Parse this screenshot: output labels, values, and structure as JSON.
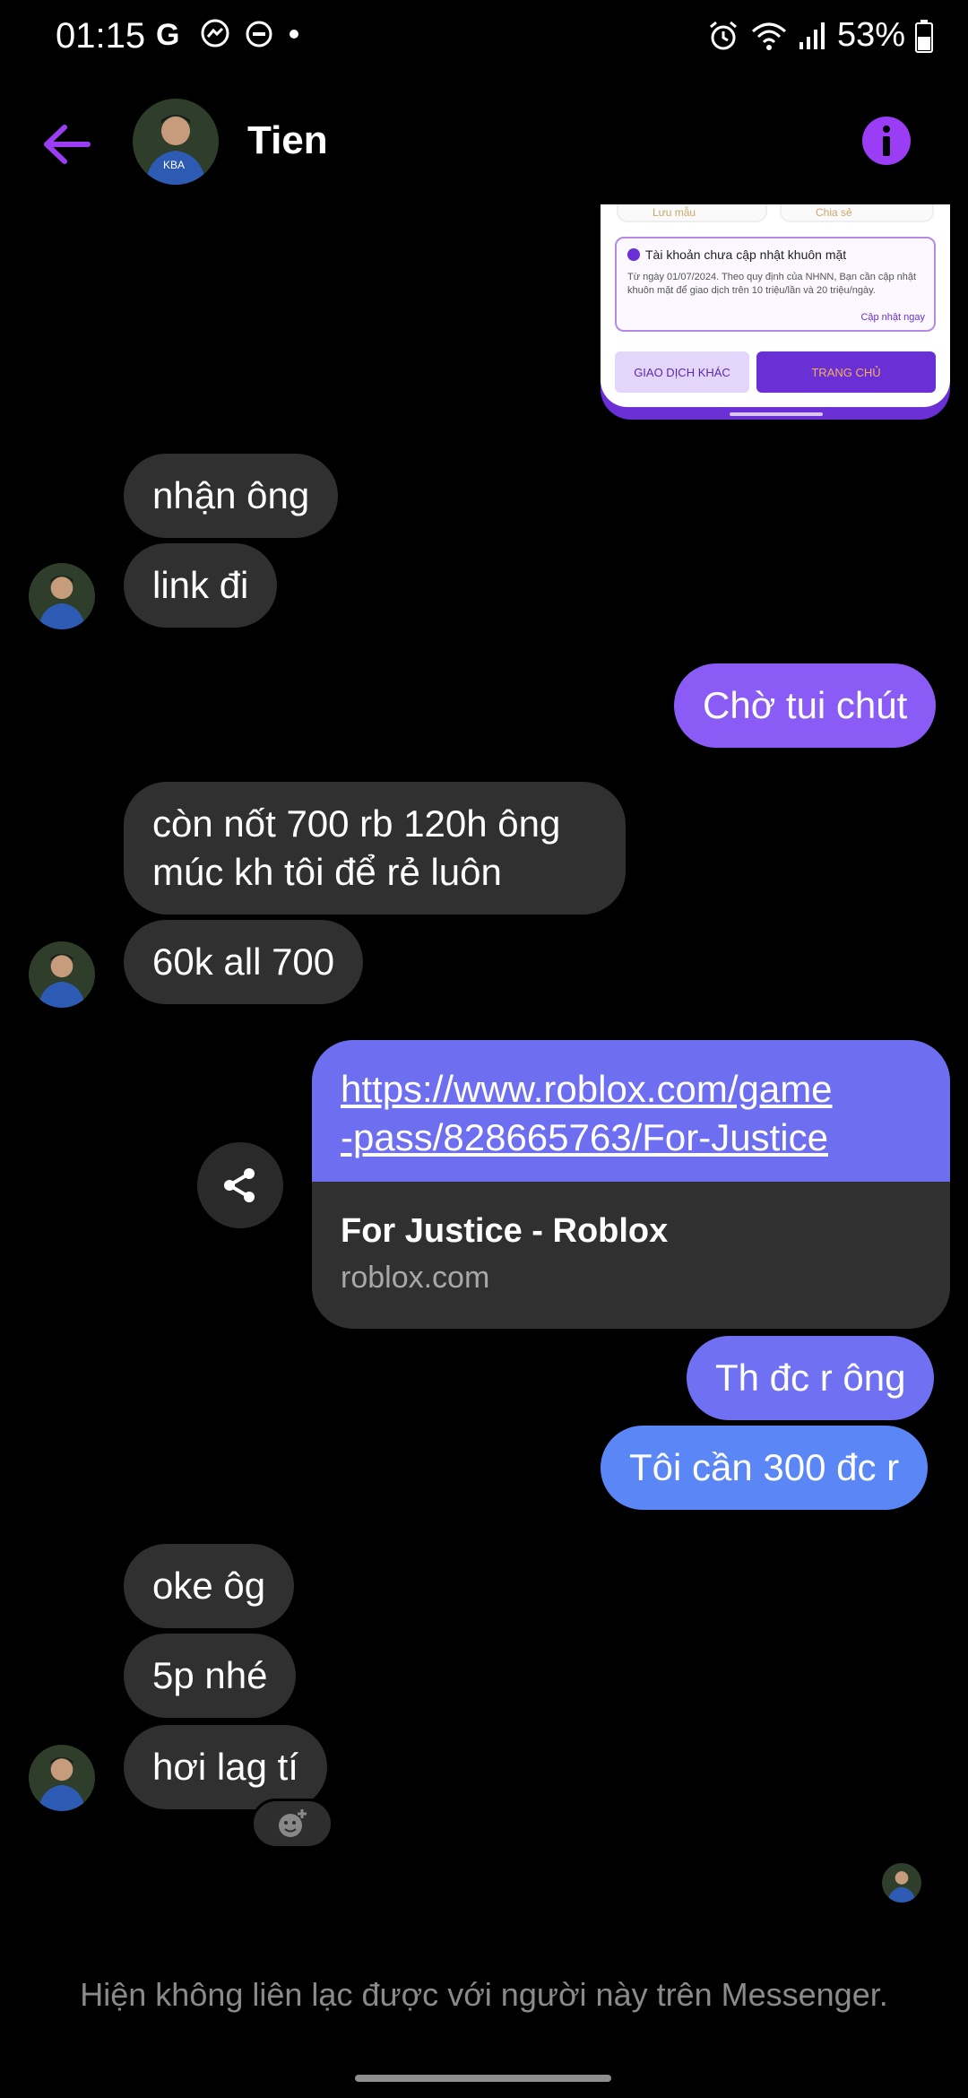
{
  "status_bar": {
    "time": "01:15",
    "battery_pct": "53%",
    "icons": [
      "google-icon",
      "messenger-icon",
      "dnd-icon",
      "dot-icon",
      "alarm-icon",
      "wifi-icon",
      "signal-icon",
      "battery-icon"
    ]
  },
  "header": {
    "contact_name": "Tien",
    "accent": "#9b3df5"
  },
  "image_message": {
    "card_left_label": "Lưu mẫu",
    "card_right_label": "Chia sẻ",
    "warning_title": "Tài khoản chưa cập nhật khuôn mặt",
    "warning_body": "Từ ngày 01/07/2024. Theo quy định của NHNN, Bạn cần cập nhật khuôn mặt để giao dịch trên 10 triệu/lần và 20 triệu/ngày.",
    "warning_link": "Cập nhật ngay",
    "button_other": "GIAO DỊCH KHÁC",
    "button_home": "TRANG CHỦ"
  },
  "messages": {
    "m1": "nhận ông",
    "m2": "link đi",
    "m3": "Chờ tui chút",
    "m4_line1": "còn nốt 700 rb 120h ông",
    "m4_line2": "múc kh tôi để rẻ luôn",
    "m5": "60k all 700",
    "m6": "Th đc r ông",
    "m7": "Tôi cần 300 đc r",
    "m8": "oke ôg",
    "m9": "5p nhé",
    "m10": "hơi lag tí"
  },
  "link_preview": {
    "url_line1": "https://www.roblox.com/game",
    "url_line2": "-pass/828665763/For-Justice",
    "title": "For Justice - Roblox",
    "domain": "roblox.com"
  },
  "colors": {
    "outgoing_1": "#8a5cf5",
    "outgoing_2": "#6f71f2",
    "outgoing_3": "#5b86f5",
    "incoming": "#303030"
  },
  "footer": {
    "note": "Hiện không liên lạc được với người này trên Messenger."
  }
}
